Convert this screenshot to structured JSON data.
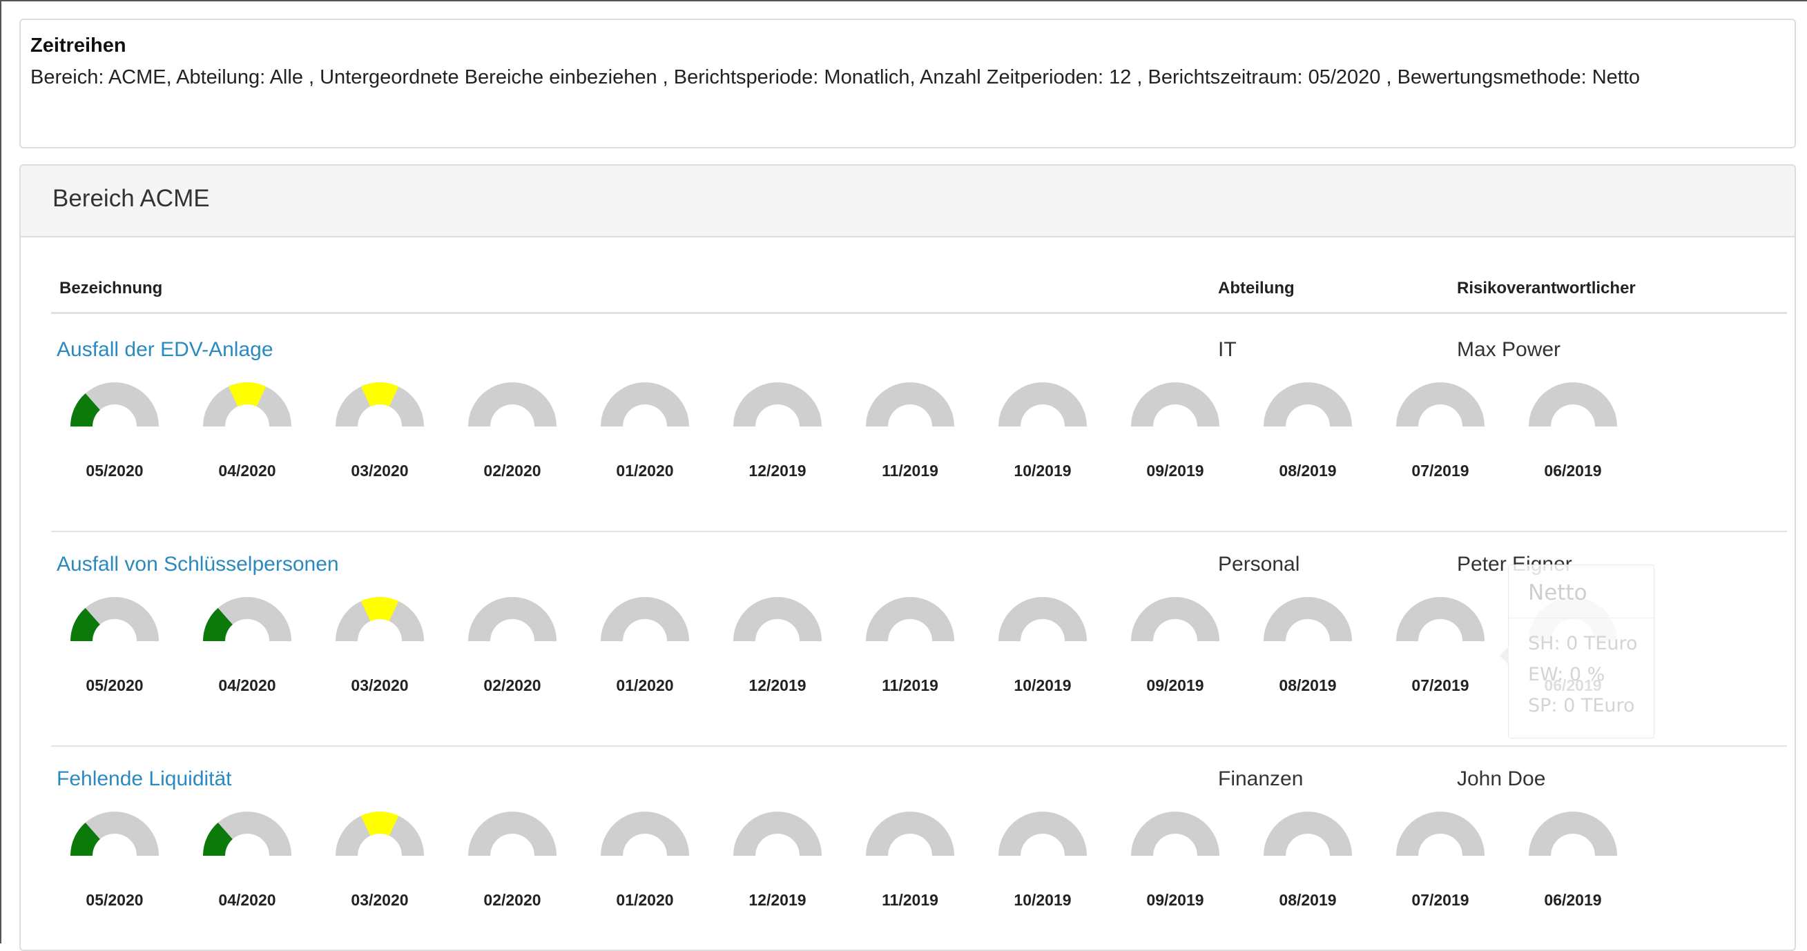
{
  "filter": {
    "title": "Zeitreihen",
    "description": "Bereich: ACME, Abteilung: Alle , Untergeordnete Bereiche einbeziehen , Berichtsperiode: Monatlich, Anzahl Zeitperioden: 12 , Berichtszeitraum: 05/2020 , Bewertungsmethode: Netto"
  },
  "area": {
    "title": "Bereich ACME"
  },
  "table": {
    "headers": {
      "name": "Bezeichnung",
      "department": "Abteilung",
      "owner": "Risikoverantwortlicher"
    }
  },
  "periods": [
    "05/2020",
    "04/2020",
    "03/2020",
    "02/2020",
    "01/2020",
    "12/2019",
    "11/2019",
    "10/2019",
    "09/2019",
    "08/2019",
    "07/2019",
    "06/2019"
  ],
  "colors": {
    "green": "#0b7a0b",
    "yellow": "#ffff00",
    "empty": "#cfcfcf",
    "link": "#2a8ac0"
  },
  "rows": [
    {
      "name": "Ausfall der EDV-Anlage",
      "department": "IT",
      "owner": "Max Power",
      "gauges": [
        {
          "level": 0.27,
          "color": "green"
        },
        {
          "level": 0.64,
          "color": "yellow"
        },
        {
          "level": 0.64,
          "color": "yellow"
        },
        {
          "level": 0,
          "color": "empty"
        },
        {
          "level": 0,
          "color": "empty"
        },
        {
          "level": 0,
          "color": "empty"
        },
        {
          "level": 0,
          "color": "empty"
        },
        {
          "level": 0,
          "color": "empty"
        },
        {
          "level": 0,
          "color": "empty"
        },
        {
          "level": 0,
          "color": "empty"
        },
        {
          "level": 0,
          "color": "empty"
        },
        {
          "level": 0,
          "color": "empty"
        }
      ]
    },
    {
      "name": "Ausfall von Schlüsselpersonen",
      "department": "Personal",
      "owner": "Peter Eigner",
      "gauges": [
        {
          "level": 0.27,
          "color": "green"
        },
        {
          "level": 0.27,
          "color": "green"
        },
        {
          "level": 0.64,
          "color": "yellow"
        },
        {
          "level": 0,
          "color": "empty"
        },
        {
          "level": 0,
          "color": "empty"
        },
        {
          "level": 0,
          "color": "empty"
        },
        {
          "level": 0,
          "color": "empty"
        },
        {
          "level": 0,
          "color": "empty"
        },
        {
          "level": 0,
          "color": "empty"
        },
        {
          "level": 0,
          "color": "empty"
        },
        {
          "level": 0,
          "color": "empty"
        },
        {
          "level": 0,
          "color": "empty"
        }
      ]
    },
    {
      "name": "Fehlende Liquidität",
      "department": "Finanzen",
      "owner": "John Doe",
      "gauges": [
        {
          "level": 0.27,
          "color": "green"
        },
        {
          "level": 0.27,
          "color": "green"
        },
        {
          "level": 0.64,
          "color": "yellow"
        },
        {
          "level": 0,
          "color": "empty"
        },
        {
          "level": 0,
          "color": "empty"
        },
        {
          "level": 0,
          "color": "empty"
        },
        {
          "level": 0,
          "color": "empty"
        },
        {
          "level": 0,
          "color": "empty"
        },
        {
          "level": 0,
          "color": "empty"
        },
        {
          "level": 0,
          "color": "empty"
        },
        {
          "level": 0,
          "color": "empty"
        },
        {
          "level": 0,
          "color": "empty"
        }
      ]
    }
  ],
  "tooltip": {
    "title": "Netto",
    "lines": [
      "SH: 0 TEuro",
      "EW: 0 %",
      "SP: 0 TEuro"
    ]
  }
}
